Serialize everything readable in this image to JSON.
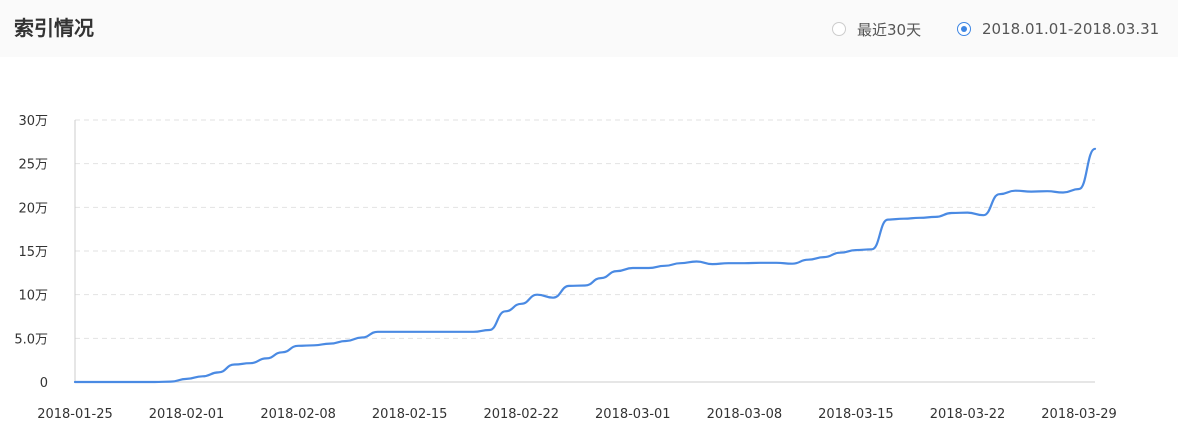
{
  "header": {
    "title": "索引情况",
    "options": [
      {
        "label": "最近30天",
        "selected": false
      },
      {
        "label": "2018.01.01-2018.03.31",
        "selected": true
      }
    ]
  },
  "colors": {
    "line": "#4a8ae3",
    "accent": "#3e86e3",
    "grid": "#e2e2e2",
    "axis": "#cccccc",
    "text": "#333333"
  },
  "chart_data": {
    "type": "line",
    "xlabel": "",
    "ylabel": "",
    "y_ticks": [
      {
        "value": 0,
        "label": "0"
      },
      {
        "value": 50000,
        "label": "5.0万"
      },
      {
        "value": 100000,
        "label": "10万"
      },
      {
        "value": 150000,
        "label": "15万"
      },
      {
        "value": 200000,
        "label": "20万"
      },
      {
        "value": 250000,
        "label": "25万"
      },
      {
        "value": 300000,
        "label": "30万"
      }
    ],
    "x_ticks": [
      {
        "date": "2018-01-25",
        "label": "2018-01-25"
      },
      {
        "date": "2018-02-01",
        "label": "2018-02-01"
      },
      {
        "date": "2018-02-08",
        "label": "2018-02-08"
      },
      {
        "date": "2018-02-15",
        "label": "2018-02-15"
      },
      {
        "date": "2018-02-22",
        "label": "2018-02-22"
      },
      {
        "date": "2018-03-01",
        "label": "2018-03-01"
      },
      {
        "date": "2018-03-08",
        "label": "2018-03-08"
      },
      {
        "date": "2018-03-15",
        "label": "2018-03-15"
      },
      {
        "date": "2018-03-22",
        "label": "2018-03-22"
      },
      {
        "date": "2018-03-29",
        "label": "2018-03-29"
      }
    ],
    "ylim": [
      0,
      300000
    ],
    "xlim": [
      "2018-01-25",
      "2018-03-30"
    ],
    "grid": true,
    "legend": "none",
    "series": [
      {
        "points": [
          [
            "2018-01-25",
            0
          ],
          [
            "2018-01-26",
            0
          ],
          [
            "2018-01-27",
            0
          ],
          [
            "2018-01-28",
            0
          ],
          [
            "2018-01-29",
            0
          ],
          [
            "2018-01-30",
            0
          ],
          [
            "2018-01-31",
            500
          ],
          [
            "2018-02-01",
            3500
          ],
          [
            "2018-02-02",
            6500
          ],
          [
            "2018-02-03",
            11000
          ],
          [
            "2018-02-04",
            20000
          ],
          [
            "2018-02-05",
            21500
          ],
          [
            "2018-02-06",
            27000
          ],
          [
            "2018-02-07",
            34000
          ],
          [
            "2018-02-08",
            41500
          ],
          [
            "2018-02-09",
            42000
          ],
          [
            "2018-02-10",
            44000
          ],
          [
            "2018-02-11",
            47000
          ],
          [
            "2018-02-12",
            51000
          ],
          [
            "2018-02-13",
            57500
          ],
          [
            "2018-02-14",
            57500
          ],
          [
            "2018-02-15",
            57500
          ],
          [
            "2018-02-16",
            57500
          ],
          [
            "2018-02-17",
            57500
          ],
          [
            "2018-02-18",
            57500
          ],
          [
            "2018-02-19",
            57500
          ],
          [
            "2018-02-20",
            59500
          ],
          [
            "2018-02-21",
            81000
          ],
          [
            "2018-02-22",
            89500
          ],
          [
            "2018-02-23",
            100000
          ],
          [
            "2018-02-24",
            96500
          ],
          [
            "2018-02-25",
            110000
          ],
          [
            "2018-02-26",
            110500
          ],
          [
            "2018-02-27",
            119000
          ],
          [
            "2018-02-28",
            127000
          ],
          [
            "2018-03-01",
            130500
          ],
          [
            "2018-03-02",
            130500
          ],
          [
            "2018-03-03",
            133000
          ],
          [
            "2018-03-04",
            136000
          ],
          [
            "2018-03-05",
            138000
          ],
          [
            "2018-03-06",
            135000
          ],
          [
            "2018-03-07",
            136000
          ],
          [
            "2018-03-08",
            136000
          ],
          [
            "2018-03-09",
            136500
          ],
          [
            "2018-03-10",
            136500
          ],
          [
            "2018-03-11",
            135500
          ],
          [
            "2018-03-12",
            140000
          ],
          [
            "2018-03-13",
            143000
          ],
          [
            "2018-03-14",
            148000
          ],
          [
            "2018-03-15",
            151000
          ],
          [
            "2018-03-16",
            152000
          ],
          [
            "2018-03-17",
            186000
          ],
          [
            "2018-03-18",
            187000
          ],
          [
            "2018-03-19",
            188000
          ],
          [
            "2018-03-20",
            189000
          ],
          [
            "2018-03-21",
            193500
          ],
          [
            "2018-03-22",
            194000
          ],
          [
            "2018-03-23",
            191000
          ],
          [
            "2018-03-24",
            215000
          ],
          [
            "2018-03-25",
            219000
          ],
          [
            "2018-03-26",
            218000
          ],
          [
            "2018-03-27",
            218500
          ],
          [
            "2018-03-28",
            217000
          ],
          [
            "2018-03-29",
            221000
          ],
          [
            "2018-03-30",
            267000
          ]
        ]
      }
    ]
  }
}
